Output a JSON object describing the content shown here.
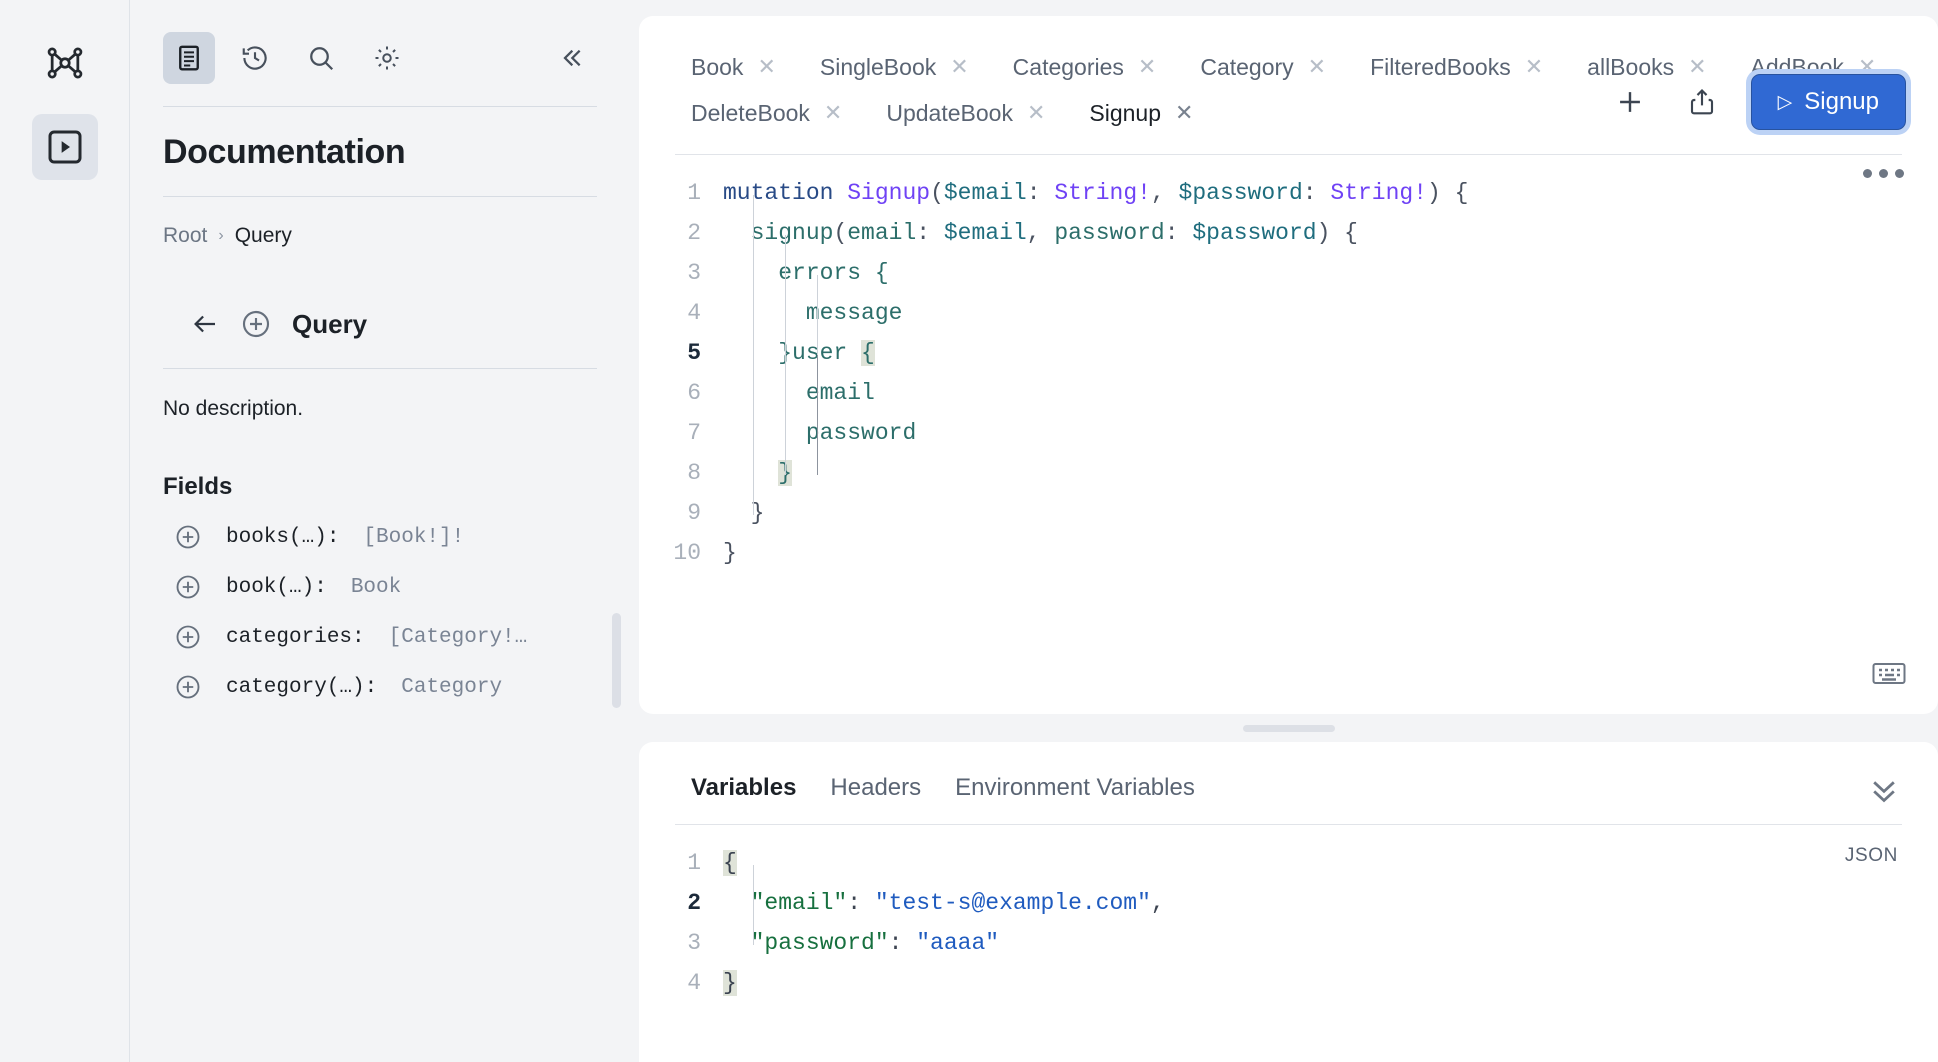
{
  "rail": {
    "items": [
      {
        "name": "graph-logo-icon",
        "label": "Graph"
      },
      {
        "name": "play-panel-icon",
        "label": "Explorer"
      }
    ]
  },
  "docs": {
    "tools": [
      {
        "name": "documentation-icon",
        "label": "Documentation"
      },
      {
        "name": "history-icon",
        "label": "History"
      },
      {
        "name": "search-icon",
        "label": "Search"
      },
      {
        "name": "settings-gear-icon",
        "label": "Settings"
      }
    ],
    "collapse_label": "«",
    "title": "Documentation",
    "breadcrumb": {
      "root": "Root",
      "separator": "›",
      "current": "Query"
    },
    "type_name": "Query",
    "description": "No description.",
    "fields_heading": "Fields",
    "fields": [
      {
        "name": "books(…):",
        "type": "[Book!]!"
      },
      {
        "name": "book(…):",
        "type": "Book"
      },
      {
        "name": "categories:",
        "type": "[Category!…"
      },
      {
        "name": "category(…):",
        "type": "Category"
      }
    ]
  },
  "tabs": [
    {
      "label": "Book",
      "active": false
    },
    {
      "label": "SingleBook",
      "active": false
    },
    {
      "label": "Categories",
      "active": false
    },
    {
      "label": "Category",
      "active": false
    },
    {
      "label": "FilteredBooks",
      "active": false
    },
    {
      "label": "allBooks",
      "active": false
    },
    {
      "label": "AddBook",
      "active": false
    },
    {
      "label": "DeleteBook",
      "active": false
    },
    {
      "label": "UpdateBook",
      "active": false
    },
    {
      "label": "Signup",
      "active": true
    }
  ],
  "tab_close_glyph": "✕",
  "toolbar": {
    "add_tab_label": "+",
    "share_label": "share-icon",
    "run_button_label": "Signup",
    "run_button_glyph": "▷",
    "run_button_color": "#3069d3",
    "more_menu_label": "•••",
    "keyboard_shortcut_label": "keyboard-icon"
  },
  "editor": {
    "lines": [
      {
        "n": "1",
        "current": false
      },
      {
        "n": "2",
        "current": false
      },
      {
        "n": "3",
        "current": false
      },
      {
        "n": "4",
        "current": false
      },
      {
        "n": "5",
        "current": true
      },
      {
        "n": "6",
        "current": false
      },
      {
        "n": "7",
        "current": false
      },
      {
        "n": "8",
        "current": false
      },
      {
        "n": "9",
        "current": false
      },
      {
        "n": "10",
        "current": false
      }
    ],
    "code": {
      "l1_kw": "mutation",
      "l1_name": "Signup",
      "l1_open": "(",
      "l1_v1": "$email",
      "l1_c1": ": ",
      "l1_t1": "String!",
      "l1_comma": ", ",
      "l1_v2": "$password",
      "l1_c2": ": ",
      "l1_t2": "String!",
      "l1_close": ") {",
      "l2_field": "signup",
      "l2_open": "(",
      "l2_a1": "email",
      "l2_c1": ": ",
      "l2_v1": "$email",
      "l2_comma": ", ",
      "l2_a2": "password",
      "l2_c2": ": ",
      "l2_v2": "$password",
      "l2_close": ") {",
      "l3": "errors {",
      "l4": "message",
      "l5_a": "}user ",
      "l5_brace": "{",
      "l6": "email",
      "l7": "password",
      "l8_brace": "}",
      "l9": "}",
      "l10": "}"
    }
  },
  "variables_panel": {
    "tabs": [
      {
        "label": "Variables",
        "active": true
      },
      {
        "label": "Headers",
        "active": false
      },
      {
        "label": "Environment Variables",
        "active": false
      }
    ],
    "collapse_glyph": "⌄⌄",
    "format_badge": "JSON",
    "lines": [
      {
        "n": "1",
        "current": false
      },
      {
        "n": "2",
        "current": true
      },
      {
        "n": "3",
        "current": false
      },
      {
        "n": "4",
        "current": false
      }
    ],
    "json": {
      "open_brace": "{",
      "k1": "\"email\"",
      "c1": ": ",
      "v1": "\"test-s@example.com\"",
      "t1": ",",
      "k2": "\"password\"",
      "c2": ": ",
      "v2": "\"aaaa\"",
      "close_brace": "}"
    }
  }
}
